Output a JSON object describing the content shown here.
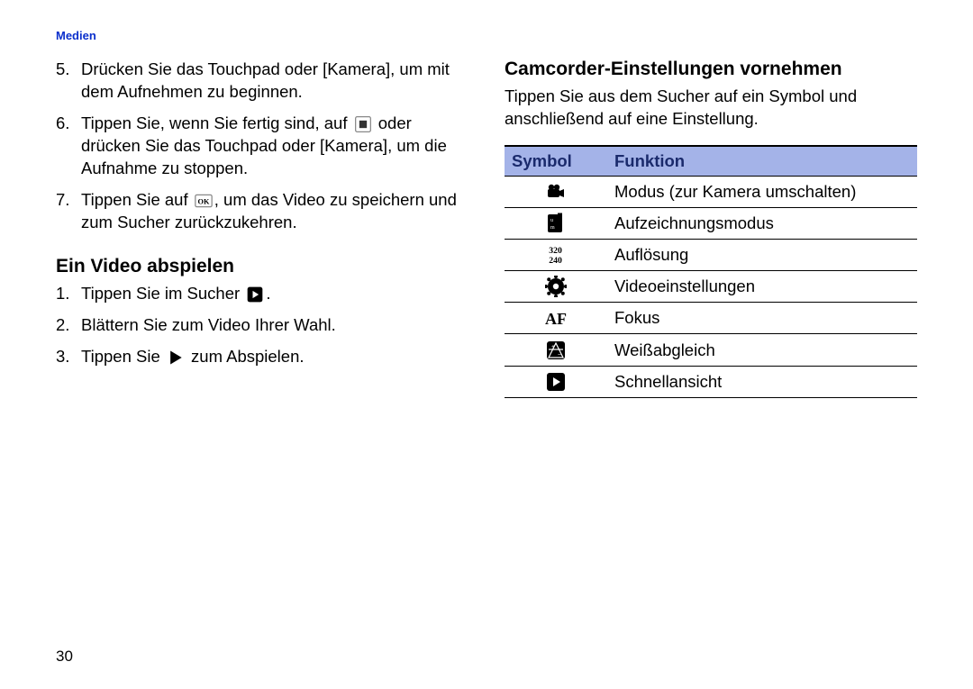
{
  "header": "Medien",
  "page_number": "30",
  "left": {
    "steps_a": [
      {
        "n": "5.",
        "before": "Drücken Sie das Touchpad oder [Kamera], um mit dem Aufnehmen zu beginnen.",
        "icon": null,
        "after": ""
      },
      {
        "n": "6.",
        "before": "Tippen Sie, wenn Sie fertig sind, auf ",
        "icon": "stop",
        "after": " oder drücken Sie das Touchpad oder [Kamera], um die Aufnahme zu stoppen."
      },
      {
        "n": "7.",
        "before": "Tippen Sie auf ",
        "icon": "ok",
        "after": ", um das Video zu speichern und zum Sucher zurückzukehren."
      }
    ],
    "heading_b": "Ein Video abspielen",
    "steps_b": [
      {
        "n": "1.",
        "before": "Tippen Sie im Sucher ",
        "icon": "quickview",
        "after": "."
      },
      {
        "n": "2.",
        "before": "Blättern Sie zum Video Ihrer Wahl.",
        "icon": null,
        "after": ""
      },
      {
        "n": "3.",
        "before": "Tippen Sie ",
        "icon": "play",
        "after": " zum Abspielen."
      }
    ]
  },
  "right": {
    "heading": "Camcorder-Einstellungen vornehmen",
    "intro": "Tippen Sie aus dem Sucher auf ein Symbol und anschließend auf eine Einstellung.",
    "table": {
      "col1": "Symbol",
      "col2": "Funktion",
      "rows": [
        {
          "icon": "camcorder",
          "text": "Modus (zur Kamera umschalten)"
        },
        {
          "icon": "recmode",
          "text": "Aufzeichnungsmodus"
        },
        {
          "icon": "resolution",
          "text": "Auflösung"
        },
        {
          "icon": "gear",
          "text": "Videoeinstellungen"
        },
        {
          "icon": "af",
          "text": "Fokus"
        },
        {
          "icon": "wb",
          "text": "Weißabgleich"
        },
        {
          "icon": "quickview",
          "text": "Schnellansicht"
        }
      ]
    }
  }
}
